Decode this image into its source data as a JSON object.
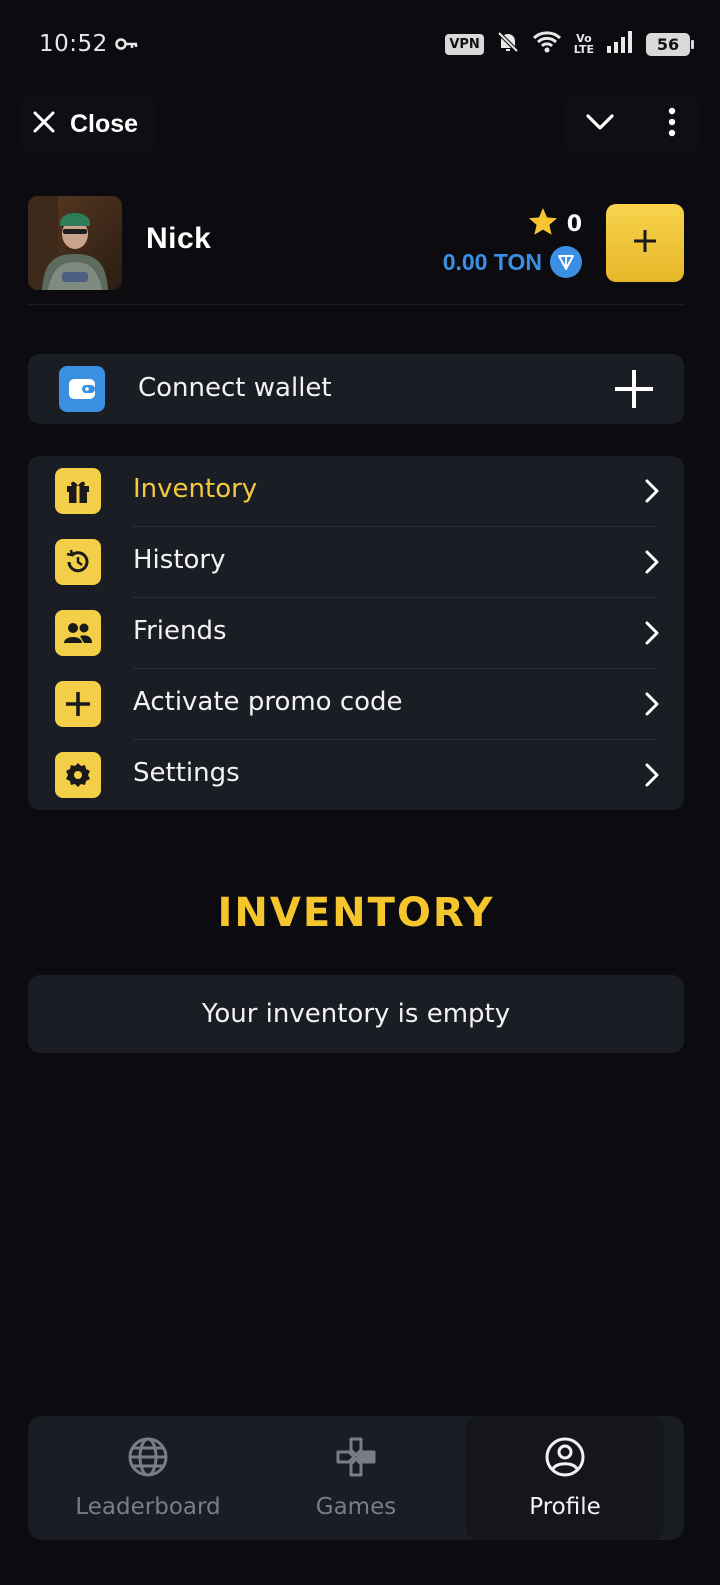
{
  "status_bar": {
    "time": "10:52",
    "vpn_label": "VPN",
    "network_label": "Vo\nLTE",
    "battery_level": "56",
    "icons": [
      "key-icon",
      "vpn-icon",
      "bell-off-icon",
      "wifi-icon",
      "volte-icon",
      "signal-icon",
      "battery-icon"
    ]
  },
  "top_bar": {
    "close_label": "Close",
    "icons": [
      "close-icon",
      "chevron-down-icon",
      "more-vertical-icon"
    ]
  },
  "profile": {
    "name": "Nick",
    "stars": "0",
    "ton_balance": "0.00 TON",
    "icons": [
      "star-icon",
      "ton-icon",
      "plus-icon"
    ]
  },
  "wallet": {
    "label": "Connect wallet",
    "icons": [
      "wallet-icon",
      "plus-icon"
    ]
  },
  "menu": {
    "items": [
      {
        "label": "Inventory",
        "icon": "gift-icon",
        "active": true
      },
      {
        "label": "History",
        "icon": "history-icon",
        "active": false
      },
      {
        "label": "Friends",
        "icon": "friends-icon",
        "active": false
      },
      {
        "label": "Activate promo code",
        "icon": "plus-icon",
        "active": false
      },
      {
        "label": "Settings",
        "icon": "gear-icon",
        "active": false
      }
    ]
  },
  "inventory": {
    "title": "INVENTORY",
    "empty_text": "Your inventory is empty"
  },
  "bottom_nav": {
    "items": [
      {
        "label": "Leaderboard",
        "icon": "globe-icon",
        "active": false
      },
      {
        "label": "Games",
        "icon": "gamepad-icon",
        "active": false
      },
      {
        "label": "Profile",
        "icon": "user-circle-icon",
        "active": true
      }
    ]
  },
  "colors": {
    "background": "#0b0b10",
    "card": "#1a1d24",
    "accent_yellow": "#f3cf47",
    "ton_blue": "#3b8fe4",
    "muted_text": "#7a7d86"
  }
}
